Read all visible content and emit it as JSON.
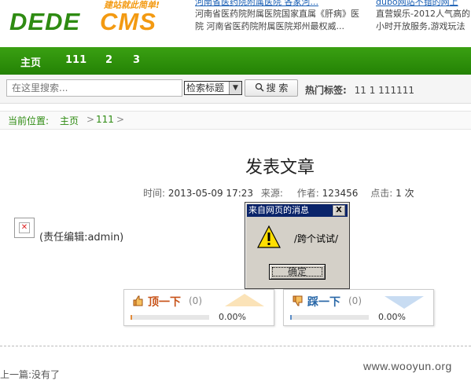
{
  "header": {
    "logo_left": "DEDE",
    "logo_right": "CMS",
    "logo_tagline": "建站就此简单!",
    "ads_col1": [
      "河南省医药院附属医院 各家河...",
      "河南省医药院附属医院国家直属《肝病》医",
      "院 河南省医药院附属医院郑州最权威..."
    ],
    "ads_col2": [
      "dubo网站不错的网上",
      "直营娱乐-2012人气高的",
      "小时开放服务,游戏玩法"
    ]
  },
  "nav": {
    "items": [
      "主页",
      "111",
      "2",
      "3"
    ]
  },
  "search": {
    "placeholder": "在这里搜索...",
    "select_value": "检索标题",
    "button_label": "搜 索",
    "hot_label": "热门标签:",
    "hot_tags": "11  1  111111"
  },
  "breadcrumb": {
    "prefix": "当前位置:",
    "items": [
      "主页",
      "111"
    ],
    "separator": ">"
  },
  "article": {
    "title": "发表文章",
    "time_label": "时间:",
    "time": "2013-05-09 17:23",
    "source_label": "来源:",
    "author_label": "作者:",
    "author": "123456",
    "hits_label": "点击:",
    "hits": "1",
    "hits_unit": "次",
    "editor": "(责任编辑:admin)"
  },
  "vote": {
    "up": {
      "label": "顶一下",
      "count": "(0)",
      "percent": "0.00%",
      "fraction": 0.0,
      "color": "#c8541a",
      "bar_color": "#e38b3a"
    },
    "down": {
      "label": "踩一下",
      "count": "(0)",
      "percent": "0.00%",
      "fraction": 0.0,
      "color": "#2a68a8",
      "bar_color": "#5b8dc7"
    }
  },
  "prev_text": "上一篇:没有了",
  "watermark": "www.wooyun.org",
  "dialog": {
    "title": "来自网页的消息",
    "close": "X",
    "message": "/跨个试试/",
    "ok_label": "确定"
  },
  "colors": {
    "nav_green": "#2e8f0c",
    "logo_green": "#2e8b12",
    "logo_orange": "#f39a12",
    "dialog_title": "#0a246a"
  }
}
